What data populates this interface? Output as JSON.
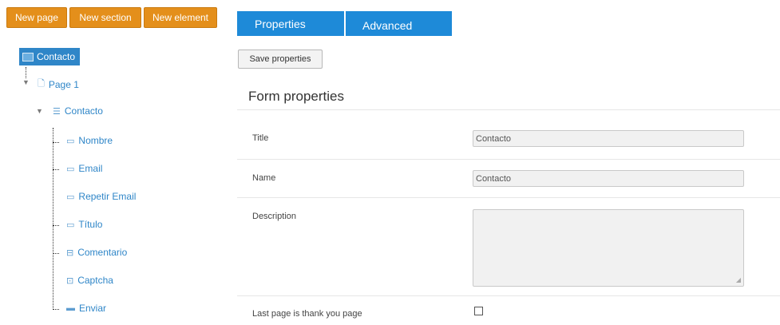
{
  "toolbar": {
    "new_page": "New page",
    "new_section": "New section",
    "new_element": "New element"
  },
  "tree": {
    "root": "Contacto",
    "page": "Page 1",
    "section": "Contacto",
    "elements": [
      {
        "label": "Nombre",
        "icon": "text-field-icon"
      },
      {
        "label": "Email",
        "icon": "text-field-icon"
      },
      {
        "label": "Repetir Email",
        "icon": "text-field-icon"
      },
      {
        "label": "Título",
        "icon": "text-field-icon"
      },
      {
        "label": "Comentario",
        "icon": "textarea-icon"
      },
      {
        "label": "Captcha",
        "icon": "captcha-icon"
      },
      {
        "label": "Enviar",
        "icon": "button-icon"
      }
    ]
  },
  "tabs": {
    "properties": "Properties",
    "advanced": "Advanced"
  },
  "save_button": "Save properties",
  "form": {
    "title": "Form properties",
    "fields": {
      "title_label": "Title",
      "title_value": "Contacto",
      "name_label": "Name",
      "name_value": "Contacto",
      "description_label": "Description",
      "description_value": "",
      "thank_you_label": "Last page is thank you page",
      "thank_you_checked": false
    }
  },
  "colors": {
    "orange_button": "#e48f1b",
    "tab_blue": "#1e8ad8",
    "tree_link": "#2f86c8"
  }
}
